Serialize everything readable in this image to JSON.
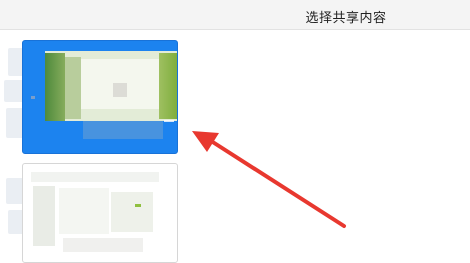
{
  "header": {
    "title": "选择共享内容"
  },
  "thumbnails": [
    {
      "state": "selected",
      "content": "blurred"
    },
    {
      "state": "unselected",
      "content": "blurred"
    }
  ],
  "annotation": {
    "icon": "red-arrow-icon",
    "color": "#e8382f"
  },
  "colors": {
    "selection": "#1c83ef",
    "header_bg": "#f4f4f4"
  }
}
